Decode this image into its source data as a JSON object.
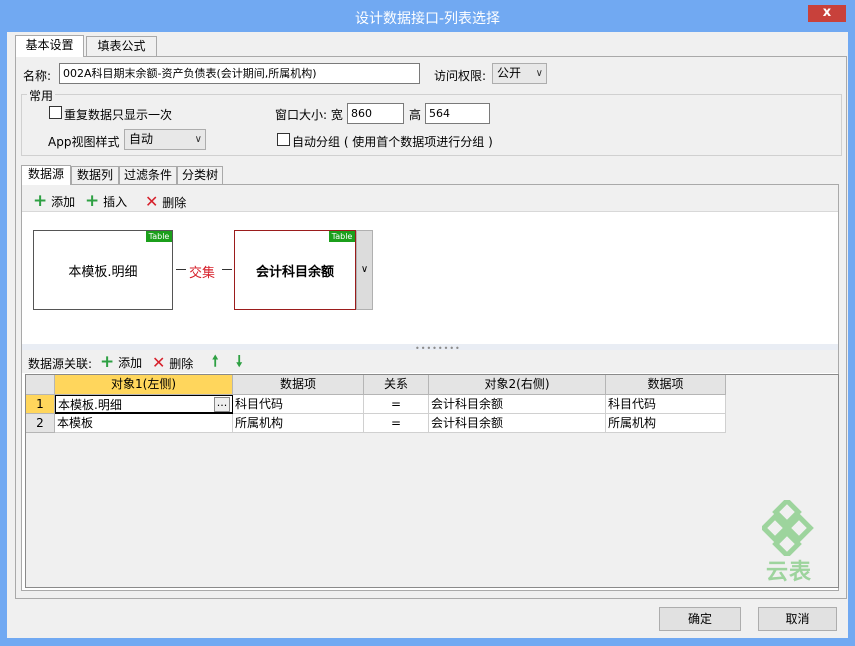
{
  "window": {
    "title": "设计数据接口-列表选择",
    "close_glyph": "x"
  },
  "main_tabs": [
    {
      "label": "基本设置"
    },
    {
      "label": "填表公式"
    }
  ],
  "basic": {
    "name_label": "名称:",
    "name_value": "002A科目期末余额-资产负债表(会计期间,所属机构)",
    "access_label": "访问权限:",
    "access_value": "公开"
  },
  "common": {
    "title": "常用",
    "dedupe_label": "重复数据只显示一次",
    "window_size_label": "窗口大小: 宽",
    "width_value": "860",
    "height_label": "高",
    "height_value": "564",
    "app_view_label": "App视图样式",
    "app_view_value": "自动",
    "auto_group_label": "自动分组 ( 使用首个数据项进行分组 )"
  },
  "inner_tabs": [
    {
      "label": "数据源"
    },
    {
      "label": "数据列"
    },
    {
      "label": "过滤条件"
    },
    {
      "label": "分类树"
    }
  ],
  "ds_toolbar": {
    "add": "添加",
    "insert": "插入",
    "delete": "删除"
  },
  "diagram": {
    "left_table": {
      "name": "本模板.明细",
      "badge": "Table"
    },
    "join_label": "交集",
    "right_table": {
      "name": "会计科目余额",
      "badge": "Table"
    }
  },
  "relation_toolbar": {
    "label": "数据源关联:",
    "add": "添加",
    "delete": "删除"
  },
  "grid": {
    "columns": [
      "对象1(左侧)",
      "数据项",
      "关系",
      "对象2(右侧)",
      "数据项"
    ],
    "rows": [
      {
        "num": "1",
        "obj1": "本模板.明细",
        "item1": "科目代码",
        "rel": "=",
        "obj2": "会计科目余额",
        "item2": "科目代码"
      },
      {
        "num": "2",
        "obj1": "本模板",
        "item1": "所属机构",
        "rel": "=",
        "obj2": "会计科目余额",
        "item2": "所属机构"
      }
    ]
  },
  "watermark": {
    "text": "云表"
  },
  "footer": {
    "ok": "确定",
    "cancel": "取消"
  },
  "colors": {
    "title_bar": "#71a9f2",
    "close": "#c8413b",
    "badge": "#1b9f1b",
    "join": "#d6202b",
    "selected_header": "#ffd65c"
  }
}
